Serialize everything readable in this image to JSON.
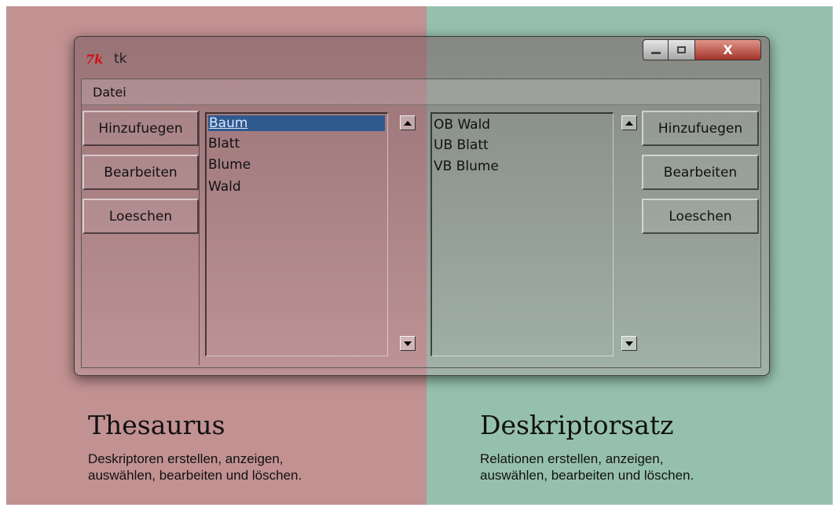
{
  "window": {
    "logo": "7k",
    "title": "tk",
    "close_label": "X"
  },
  "menu": {
    "datei": "Datei"
  },
  "left_panel": {
    "buttons": {
      "add": "Hinzufuegen",
      "edit": "Bearbeiten",
      "delete": "Loeschen"
    },
    "list": [
      "Baum",
      "Blatt",
      "Blume",
      "Wald"
    ],
    "selected_index": 0
  },
  "right_panel": {
    "buttons": {
      "add": "Hinzufuegen",
      "edit": "Bearbeiten",
      "delete": "Loeschen"
    },
    "list": [
      "OB Wald",
      "UB Blatt",
      "VB Blume"
    ]
  },
  "captions": {
    "left_title": "Thesaurus",
    "left_desc_1": "Deskriptoren erstellen, anzeigen,",
    "left_desc_2": "auswählen, bearbeiten und löschen.",
    "right_title": "Deskriptorsatz",
    "right_desc_1": "Relationen erstellen, anzeigen,",
    "right_desc_2": "auswählen, bearbeiten und löschen."
  },
  "colors": {
    "left_background": "#c29192",
    "right_background": "#96c0ae",
    "selection": "#2f5a8e",
    "close_button": "#a3332a"
  },
  "icons": [
    "tk-feather-icon",
    "minimize-icon",
    "maximize-icon",
    "close-icon",
    "scroll-up-arrow-icon",
    "scroll-down-arrow-icon"
  ]
}
